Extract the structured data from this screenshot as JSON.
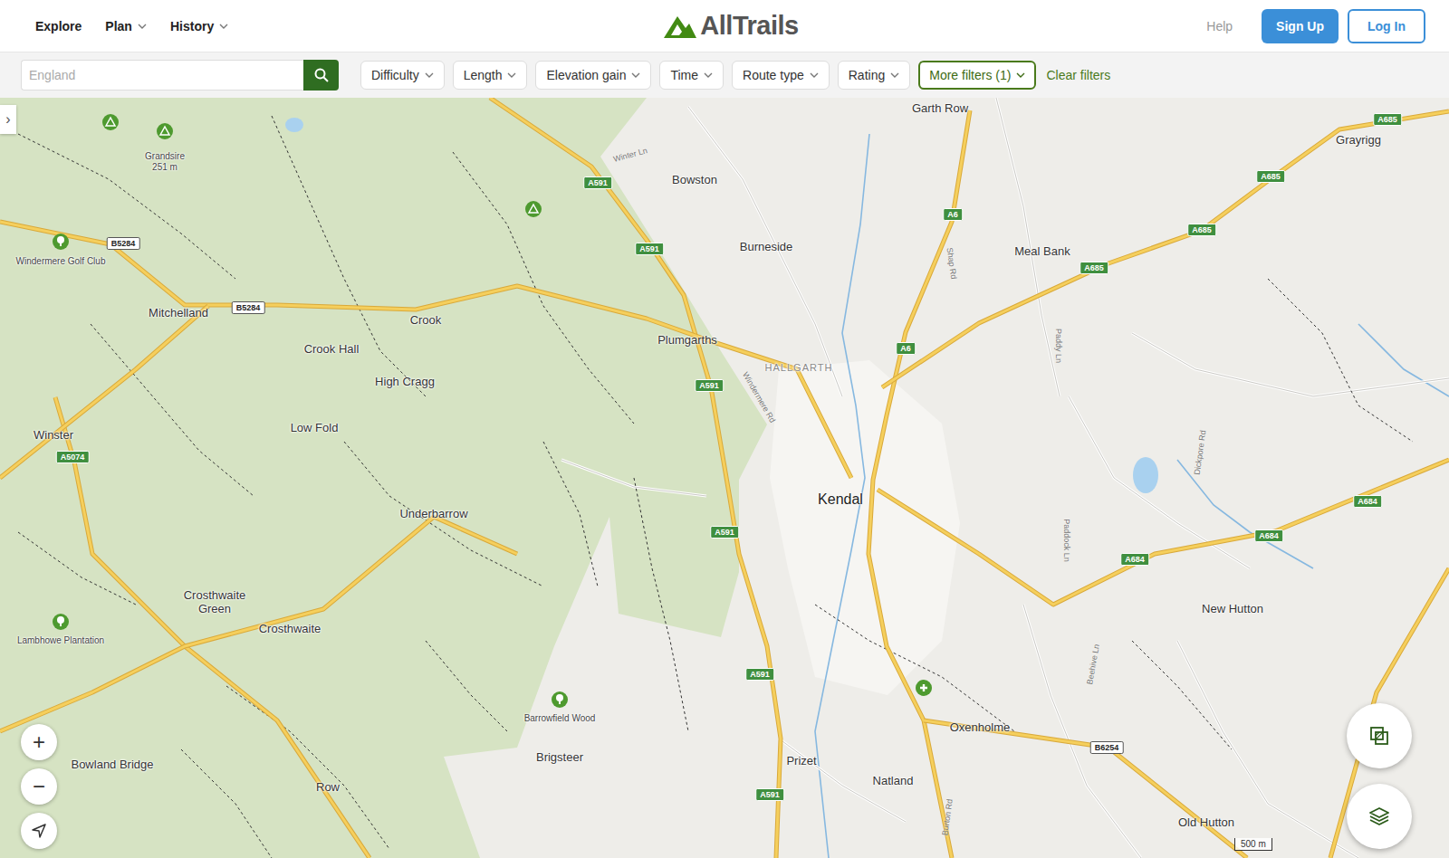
{
  "header": {
    "nav": [
      {
        "label": "Explore",
        "dropdown": false
      },
      {
        "label": "Plan",
        "dropdown": true
      },
      {
        "label": "History",
        "dropdown": true
      }
    ],
    "logo": "AllTrails",
    "help": "Help",
    "sign_up": "Sign Up",
    "log_in": "Log In"
  },
  "search": {
    "placeholder": "England"
  },
  "filters": [
    {
      "label": "Difficulty",
      "active": false
    },
    {
      "label": "Length",
      "active": false
    },
    {
      "label": "Elevation gain",
      "active": false
    },
    {
      "label": "Time",
      "active": false
    },
    {
      "label": "Route type",
      "active": false
    },
    {
      "label": "Rating",
      "active": false
    },
    {
      "label": "More filters (1)",
      "active": true
    }
  ],
  "clear_filters": "Clear filters",
  "map": {
    "sidebar_toggle": "›",
    "places": [
      {
        "lines": [
          "Garth Row"
        ],
        "kind": "village"
      },
      {
        "lines": [
          "Bowston"
        ],
        "kind": "village"
      },
      {
        "lines": [
          "Burneside"
        ],
        "kind": "village"
      },
      {
        "lines": [
          "Meal Bank"
        ],
        "kind": "village"
      },
      {
        "lines": [
          "Grayrigg"
        ],
        "kind": "village"
      },
      {
        "lines": [
          "Grandsire",
          "251 m"
        ],
        "kind": "poi"
      },
      {
        "lines": [
          "Windermere Golf Club"
        ],
        "kind": "poi"
      },
      {
        "lines": [
          "Mitchelland"
        ],
        "kind": "village"
      },
      {
        "lines": [
          "Crook"
        ],
        "kind": "village"
      },
      {
        "lines": [
          "Crook Hall"
        ],
        "kind": "village"
      },
      {
        "lines": [
          "High Cragg"
        ],
        "kind": "village"
      },
      {
        "lines": [
          "Plumgarths"
        ],
        "kind": "village"
      },
      {
        "lines": [
          "HALLGARTH"
        ],
        "kind": "district"
      },
      {
        "lines": [
          "Winster"
        ],
        "kind": "village"
      },
      {
        "lines": [
          "Low Fold"
        ],
        "kind": "village"
      },
      {
        "lines": [
          "Underbarrow"
        ],
        "kind": "village"
      },
      {
        "lines": [
          "Kendal"
        ],
        "kind": "town"
      },
      {
        "lines": [
          "Crosthwaite",
          "Green"
        ],
        "kind": "village"
      },
      {
        "lines": [
          "Crosthwaite"
        ],
        "kind": "village"
      },
      {
        "lines": [
          "Lambhowe Plantation"
        ],
        "kind": "poi"
      },
      {
        "lines": [
          "Barrowfield Wood"
        ],
        "kind": "poi"
      },
      {
        "lines": [
          "Brigsteer"
        ],
        "kind": "village"
      },
      {
        "lines": [
          "Prizet"
        ],
        "kind": "village"
      },
      {
        "lines": [
          "Natland"
        ],
        "kind": "village"
      },
      {
        "lines": [
          "Oxenholme"
        ],
        "kind": "village"
      },
      {
        "lines": [
          "New Hutton"
        ],
        "kind": "village"
      },
      {
        "lines": [
          "Old Hutton"
        ],
        "kind": "village"
      },
      {
        "lines": [
          "Bowland Bridge"
        ],
        "kind": "village"
      },
      {
        "lines": [
          "Row"
        ],
        "kind": "village"
      }
    ],
    "roads": [
      {
        "label": "A591",
        "kind": "primary"
      },
      {
        "label": "A591",
        "kind": "primary"
      },
      {
        "label": "A591",
        "kind": "primary"
      },
      {
        "label": "A591",
        "kind": "primary"
      },
      {
        "label": "A591",
        "kind": "primary"
      },
      {
        "label": "A591",
        "kind": "primary"
      },
      {
        "label": "A6",
        "kind": "primary"
      },
      {
        "label": "A6",
        "kind": "primary"
      },
      {
        "label": "A685",
        "kind": "primary"
      },
      {
        "label": "A685",
        "kind": "primary"
      },
      {
        "label": "A685",
        "kind": "primary"
      },
      {
        "label": "A685",
        "kind": "primary"
      },
      {
        "label": "A684",
        "kind": "primary"
      },
      {
        "label": "A684",
        "kind": "primary"
      },
      {
        "label": "A684",
        "kind": "primary"
      },
      {
        "label": "B5284",
        "kind": "secondary"
      },
      {
        "label": "B5284",
        "kind": "secondary"
      },
      {
        "label": "A5074",
        "kind": "primary"
      },
      {
        "label": "B6254",
        "kind": "secondary"
      }
    ],
    "streets": [
      {
        "label": "Winter Ln"
      },
      {
        "label": "Windermere Rd"
      },
      {
        "label": "Shap Rd"
      },
      {
        "label": "Paddy Ln"
      },
      {
        "label": "Dickpore Rd"
      },
      {
        "label": "Beehive Ln"
      },
      {
        "label": "Burton Rd"
      },
      {
        "label": "Paddock Ln"
      }
    ],
    "zoom": [
      "+",
      "−"
    ],
    "scale": "500 m"
  }
}
